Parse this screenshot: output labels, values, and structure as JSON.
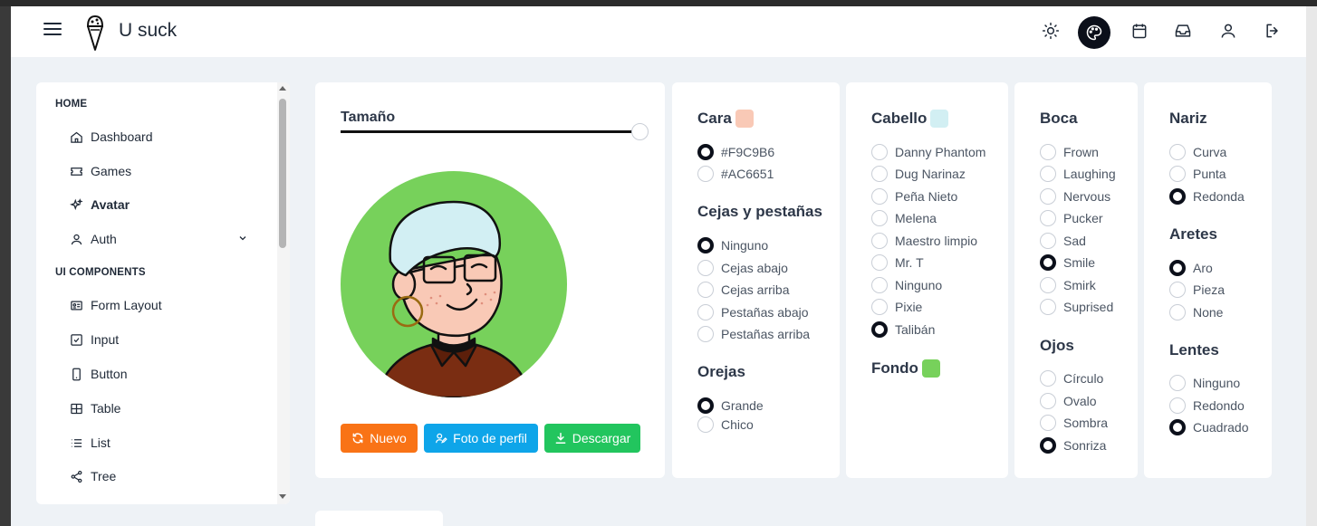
{
  "header": {
    "title": "U suck",
    "icons": [
      "menu-icon",
      "ice-cream-logo",
      "sun-icon",
      "palette-icon",
      "calendar-icon",
      "inbox-icon",
      "user-icon",
      "logout-icon"
    ]
  },
  "sidebar": {
    "section_home": "HOME",
    "section_ui": "UI COMPONENTS",
    "items": [
      {
        "label": "Dashboard",
        "icon": "home-icon"
      },
      {
        "label": "Games",
        "icon": "ticket-icon"
      },
      {
        "label": "Avatar",
        "icon": "sparkles-icon"
      },
      {
        "label": "Auth",
        "icon": "user-icon"
      },
      {
        "label": "Form Layout",
        "icon": "id-card-icon"
      },
      {
        "label": "Input",
        "icon": "check-square-icon"
      },
      {
        "label": "Button",
        "icon": "mobile-icon"
      },
      {
        "label": "Table",
        "icon": "table-icon"
      },
      {
        "label": "List",
        "icon": "list-icon"
      },
      {
        "label": "Tree",
        "icon": "share-icon"
      }
    ]
  },
  "avatar_panel": {
    "size_label": "Tamaño",
    "size_value": 1.0,
    "buttons": {
      "new": "Nuevo",
      "profile": "Foto de perfil",
      "download": "Descargar"
    }
  },
  "colors": {
    "face_swatch": "#F9C9B6",
    "hair_swatch": "#D2EFF3",
    "bg_swatch": "#77D15B",
    "btn_new": "#F97316",
    "btn_profile": "#0EA5E9",
    "btn_download": "#22C55E"
  },
  "face": {
    "title": "Cara",
    "options": [
      "#F9C9B6",
      "#AC6651"
    ],
    "selected": 0
  },
  "brows": {
    "title": "Cejas y pestañas",
    "options": [
      "Ninguno",
      "Cejas abajo",
      "Cejas arriba",
      "Pestañas abajo",
      "Pestañas arriba"
    ],
    "selected": 0
  },
  "ears": {
    "title": "Orejas",
    "options": [
      "Grande",
      "Chico"
    ],
    "selected": 0
  },
  "hair": {
    "title": "Cabello",
    "options": [
      "Danny Phantom",
      "Dug Narinaz",
      "Peña Nieto",
      "Melena",
      "Maestro limpio",
      "Mr. T",
      "Ninguno",
      "Pixie",
      "Talibán"
    ],
    "selected": 8
  },
  "background": {
    "title": "Fondo"
  },
  "mouth": {
    "title": "Boca",
    "options": [
      "Frown",
      "Laughing",
      "Nervous",
      "Pucker",
      "Sad",
      "Smile",
      "Smirk",
      "Suprised"
    ],
    "selected": 5
  },
  "eyes": {
    "title": "Ojos",
    "options": [
      "Círculo",
      "Ovalo",
      "Sombra",
      "Sonriza"
    ],
    "selected": 3
  },
  "nose": {
    "title": "Nariz",
    "options": [
      "Curva",
      "Punta",
      "Redonda"
    ],
    "selected": 2
  },
  "earrings": {
    "title": "Aretes",
    "options": [
      "Aro",
      "Pieza",
      "None"
    ],
    "selected": 0
  },
  "glasses": {
    "title": "Lentes",
    "options": [
      "Ninguno",
      "Redondo",
      "Cuadrado"
    ],
    "selected": 2
  }
}
